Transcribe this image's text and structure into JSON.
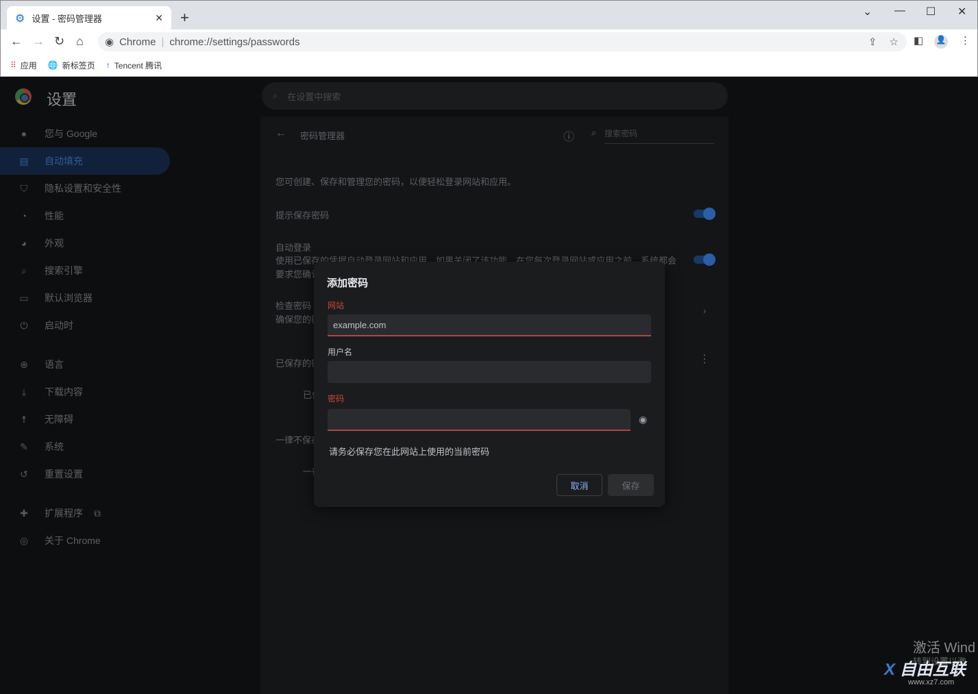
{
  "browser": {
    "tab_title": "设置 - 密码管理器",
    "omnibox_chip": "Chrome",
    "url": "chrome://settings/passwords",
    "bookmarks": [
      {
        "label": "应用",
        "icon": "apps-grid-icon"
      },
      {
        "label": "新标签页",
        "icon": "globe-icon"
      },
      {
        "label": "Tencent 腾讯",
        "icon": "tencent-logo-icon"
      }
    ]
  },
  "settings": {
    "title": "设置",
    "search_placeholder": "在设置中搜索",
    "sidebar": [
      {
        "label": "您与 Google",
        "icon": "person-icon"
      },
      {
        "label": "自动填充",
        "icon": "clipboard-icon",
        "active": true
      },
      {
        "label": "隐私设置和安全性",
        "icon": "shield-icon"
      },
      {
        "label": "性能",
        "icon": "speedometer-icon"
      },
      {
        "label": "外观",
        "icon": "palette-icon"
      },
      {
        "label": "搜索引擎",
        "icon": "search-icon"
      },
      {
        "label": "默认浏览器",
        "icon": "browser-icon"
      },
      {
        "label": "启动时",
        "icon": "power-icon"
      },
      {
        "label": "语言",
        "icon": "globe-icon"
      },
      {
        "label": "下载内容",
        "icon": "download-icon"
      },
      {
        "label": "无障碍",
        "icon": "accessibility-icon"
      },
      {
        "label": "系统",
        "icon": "wrench-icon"
      },
      {
        "label": "重置设置",
        "icon": "history-icon"
      },
      {
        "label": "扩展程序",
        "icon": "puzzle-icon"
      },
      {
        "label": "关于 Chrome",
        "icon": "chrome-icon"
      }
    ],
    "passwords": {
      "title": "密码管理器",
      "search_placeholder": "搜索密码",
      "description": "您可创建、保存和管理您的密码，以便轻松登录网站和应用。",
      "offer_save": "提示保存密码",
      "offer_save_on": true,
      "auto_signin": "自动登录",
      "auto_signin_on": true,
      "auto_signin_desc_1": "使用已保存的凭据自动登录网站和应用。如果关闭了该功能，在您每次登录网站或应用之前，系统都会",
      "auto_signin_desc_2": "要求您确认",
      "check": "检查密码",
      "check_desc": "确保您的密",
      "saved": "已保存的密",
      "saved_sub": "已保",
      "never": "一律不保存",
      "never_sub": "一律"
    }
  },
  "dialog": {
    "title": "添加密码",
    "site_label": "网站",
    "site_placeholder": "example.com",
    "username_label": "用户名",
    "password_label": "密码",
    "hint": "请务必保存您在此网站上使用的当前密码",
    "cancel": "取消",
    "save": "保存",
    "error_color": "#c9483c",
    "accent": "#8ab4f8"
  },
  "watermark": {
    "activate": "激活 Wind",
    "activate_sub": "转到设置以激",
    "site": "www.xz7.com",
    "brand": "自由互联"
  }
}
